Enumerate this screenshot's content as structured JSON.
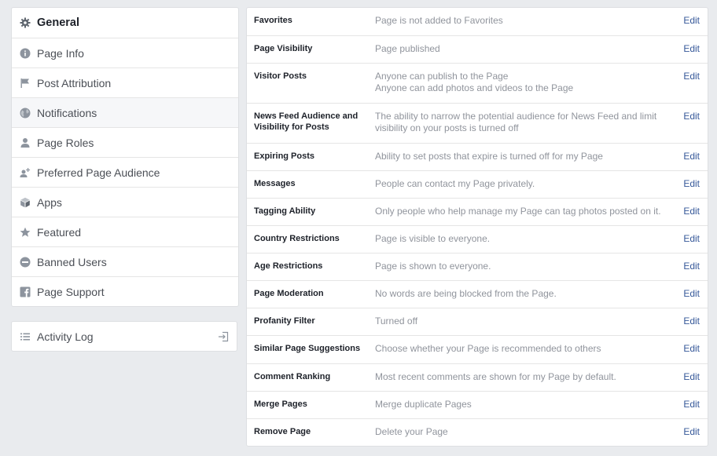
{
  "sidebar": {
    "items": [
      {
        "label": "General",
        "icon": "gear-icon",
        "active": true
      },
      {
        "label": "Page Info",
        "icon": "info-icon"
      },
      {
        "label": "Post Attribution",
        "icon": "flag-icon"
      },
      {
        "label": "Notifications",
        "icon": "globe-icon"
      },
      {
        "label": "Page Roles",
        "icon": "person-icon"
      },
      {
        "label": "Preferred Page Audience",
        "icon": "audience-icon"
      },
      {
        "label": "Apps",
        "icon": "cube-icon"
      },
      {
        "label": "Featured",
        "icon": "star-icon"
      },
      {
        "label": "Banned Users",
        "icon": "ban-icon"
      },
      {
        "label": "Page Support",
        "icon": "facebook-icon"
      }
    ]
  },
  "activity_log": {
    "label": "Activity Log",
    "icon": "list-icon",
    "right_icon": "sign-in-icon"
  },
  "settings": {
    "edit_label": "Edit",
    "rows": [
      {
        "label": "Favorites",
        "values": [
          "Page is not added to Favorites"
        ]
      },
      {
        "label": "Page Visibility",
        "values": [
          "Page published"
        ]
      },
      {
        "label": "Visitor Posts",
        "values": [
          "Anyone can publish to the Page",
          "Anyone can add photos and videos to the Page"
        ]
      },
      {
        "label": "News Feed Audience and Visibility for Posts",
        "values": [
          "The ability to narrow the potential audience for News Feed and limit",
          "visibility on your posts is turned off"
        ]
      },
      {
        "label": "Expiring Posts",
        "values": [
          "Ability to set posts that expire is turned off for my Page"
        ]
      },
      {
        "label": "Messages",
        "values": [
          "People can contact my Page privately."
        ]
      },
      {
        "label": "Tagging Ability",
        "values": [
          "Only people who help manage my Page can tag photos posted on it."
        ]
      },
      {
        "label": "Country Restrictions",
        "values": [
          "Page is visible to everyone."
        ]
      },
      {
        "label": "Age Restrictions",
        "values": [
          "Page is shown to everyone."
        ]
      },
      {
        "label": "Page Moderation",
        "values": [
          "No words are being blocked from the Page."
        ]
      },
      {
        "label": "Profanity Filter",
        "values": [
          "Turned off"
        ]
      },
      {
        "label": "Similar Page Suggestions",
        "values": [
          "Choose whether your Page is recommended to others"
        ]
      },
      {
        "label": "Comment Ranking",
        "values": [
          "Most recent comments are shown for my Page by default."
        ]
      },
      {
        "label": "Merge Pages",
        "values": [
          "Merge duplicate Pages"
        ]
      },
      {
        "label": "Remove Page",
        "values": [
          "Delete your Page"
        ]
      }
    ]
  },
  "colors": {
    "link": "#365899",
    "muted": "#90949c",
    "icon": "#8d949e"
  }
}
